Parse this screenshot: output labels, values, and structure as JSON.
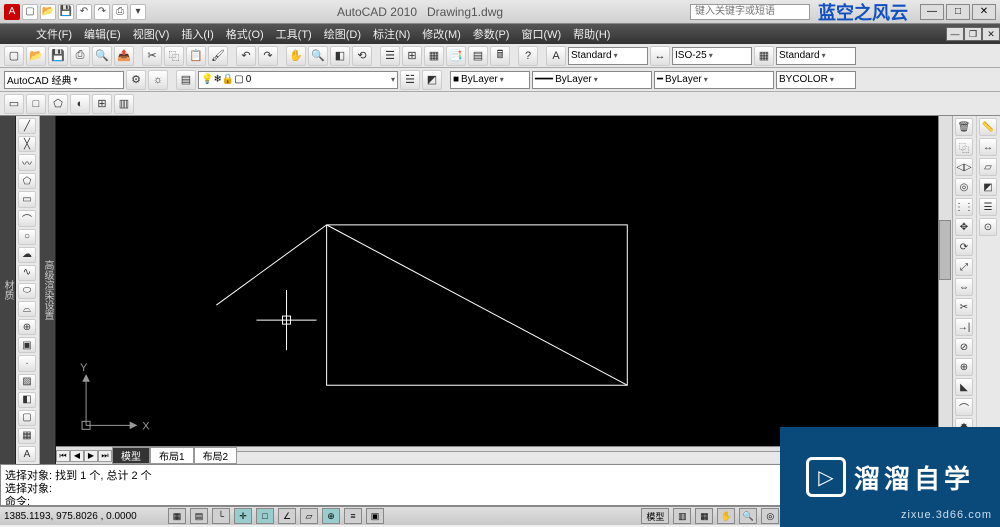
{
  "app": {
    "name": "AutoCAD 2010",
    "document": "Drawing1.dwg"
  },
  "titlebar": {
    "search_placeholder": "键入关键字或短语",
    "watermark": "蓝空之风云"
  },
  "menubar": [
    "文件(F)",
    "编辑(E)",
    "视图(V)",
    "插入(I)",
    "格式(O)",
    "工具(T)",
    "绘图(D)",
    "标注(N)",
    "修改(M)",
    "参数(P)",
    "窗口(W)",
    "帮助(H)"
  ],
  "workspace_combo": "AutoCAD 经典",
  "top_combos": {
    "text_style": "Standard",
    "dim_style": "ISO-25",
    "table_style": "Standard"
  },
  "layer_row": {
    "layer": "0",
    "color": "ByLayer",
    "linetype": "ByLayer",
    "lineweight": "ByLayer",
    "plotstyle": "BYCOLOR"
  },
  "side_tabs": {
    "left1": "材质",
    "left2": "高级渲染设置"
  },
  "layout_tabs": {
    "active": "模型",
    "t1": "布局1",
    "t2": "布局2"
  },
  "command": {
    "l1": "选择对象: 找到 1 个, 总计 2 个",
    "l2": "选择对象:",
    "l3": "命令:"
  },
  "status": {
    "coords": "1385.1193, 975.8026 , 0.0000",
    "model": "模型",
    "ws": "AutoCAD 经典"
  },
  "ucs": {
    "x": "X",
    "y": "Y"
  },
  "overlay": {
    "brand": "溜溜自学",
    "url": "zixue.3d66.com"
  }
}
